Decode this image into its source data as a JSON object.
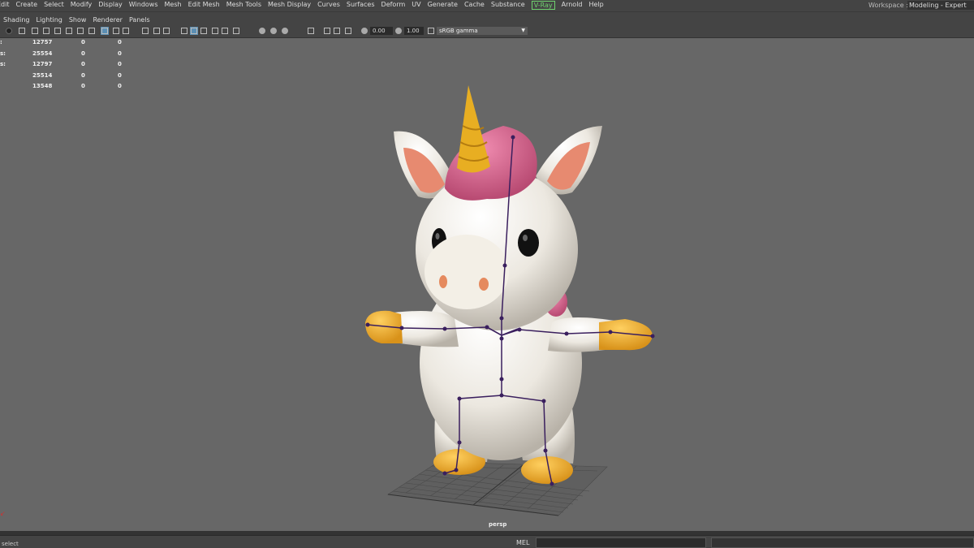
{
  "menubar": {
    "items": [
      "Edit",
      "Create",
      "Select",
      "Modify",
      "Display",
      "Windows",
      "Mesh",
      "Edit Mesh",
      "Mesh Tools",
      "Mesh Display",
      "Curves",
      "Surfaces",
      "Deform",
      "UV",
      "Generate",
      "Cache",
      "Substance",
      "V-Ray",
      "Arnold",
      "Help"
    ],
    "workspace_label": "Workspace :",
    "workspace_value": "Modeling - Expert"
  },
  "panel_menu": [
    "Shading",
    "Lighting",
    "Show",
    "Renderer",
    "Panels"
  ],
  "toolbar": {
    "exposure": "0.00",
    "gamma": "1.00",
    "color_space": "sRGB gamma"
  },
  "hud": {
    "rows": [
      {
        "label": ":",
        "v1": "12757",
        "v2": "0",
        "v3": "0"
      },
      {
        "label": "s:",
        "v1": "25554",
        "v2": "0",
        "v3": "0"
      },
      {
        "label": "s:",
        "v1": "12797",
        "v2": "0",
        "v3": "0"
      },
      {
        "label": "",
        "v1": "25514",
        "v2": "0",
        "v3": "0"
      },
      {
        "label": "",
        "v1": "13548",
        "v2": "0",
        "v3": "0"
      }
    ]
  },
  "viewport": {
    "camera_label": "persp",
    "background": "#676767"
  },
  "status": {
    "help_text": "select",
    "mel_label": "MEL"
  },
  "colors": {
    "body": "#ece8e0",
    "horn": "#e8ae22",
    "mane": "#d76590",
    "ear_inner": "#e78a70",
    "hooves": "#eaa924",
    "skeleton": "#3a1f5e",
    "vray": "#6fd36f"
  }
}
